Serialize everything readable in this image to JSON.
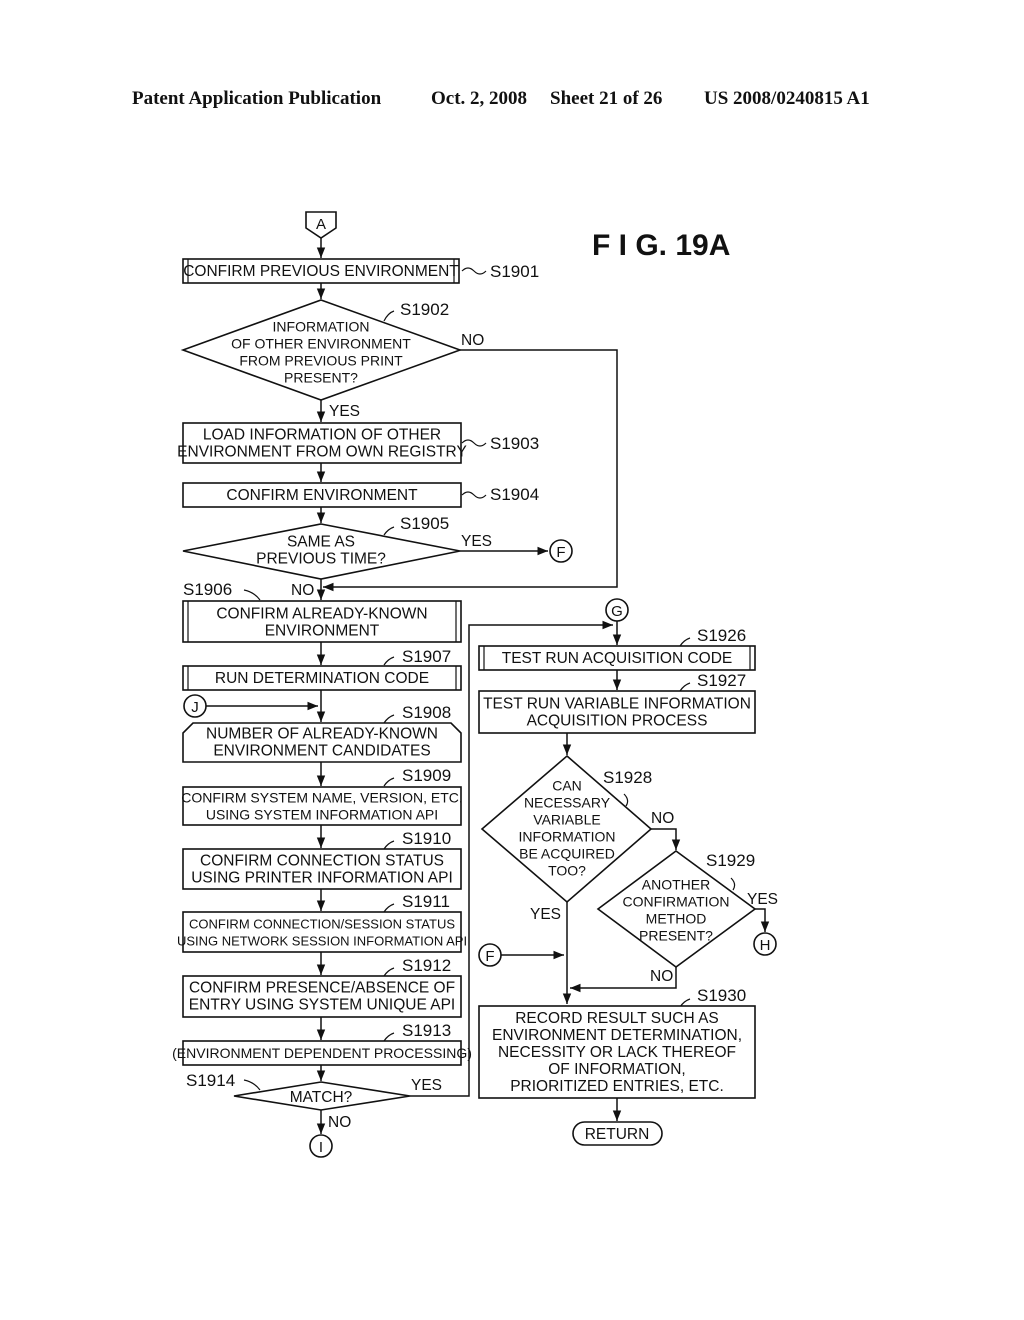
{
  "header": {
    "publication": "Patent Application Publication",
    "date": "Oct. 2, 2008",
    "sheet": "Sheet 21 of 26",
    "number": "US 2008/0240815 A1"
  },
  "figure_title": "F I G.  19A",
  "connectors": {
    "A": "A",
    "F": "F",
    "G": "G",
    "H": "H",
    "I": "I",
    "J": "J"
  },
  "branch_labels": {
    "yes": "YES",
    "no": "NO"
  },
  "steps": {
    "s1901": {
      "id": "S1901",
      "lines": [
        "CONFIRM PREVIOUS ENVIRONMENT"
      ]
    },
    "s1902": {
      "id": "S1902",
      "lines": [
        "INFORMATION",
        "OF OTHER ENVIRONMENT",
        "FROM PREVIOUS PRINT",
        "PRESENT?"
      ]
    },
    "s1903": {
      "id": "S1903",
      "lines": [
        "LOAD INFORMATION OF OTHER",
        "ENVIRONMENT FROM OWN REGISTRY"
      ]
    },
    "s1904": {
      "id": "S1904",
      "lines": [
        "CONFIRM ENVIRONMENT"
      ]
    },
    "s1905": {
      "id": "S1905",
      "lines": [
        "SAME AS",
        "PREVIOUS TIME?"
      ]
    },
    "s1906": {
      "id": "S1906",
      "lines": [
        "CONFIRM ALREADY-KNOWN",
        "ENVIRONMENT"
      ]
    },
    "s1907": {
      "id": "S1907",
      "lines": [
        "RUN DETERMINATION CODE"
      ]
    },
    "s1908": {
      "id": "S1908",
      "lines": [
        "NUMBER OF ALREADY-KNOWN",
        "ENVIRONMENT CANDIDATES"
      ]
    },
    "s1909": {
      "id": "S1909",
      "lines": [
        "CONFIRM SYSTEM NAME, VERSION, ETC.",
        "USING SYSTEM INFORMATION API"
      ]
    },
    "s1910": {
      "id": "S1910",
      "lines": [
        "CONFIRM CONNECTION STATUS",
        "USING PRINTER INFORMATION API"
      ]
    },
    "s1911": {
      "id": "S1911",
      "lines": [
        "CONFIRM CONNECTION/SESSION STATUS",
        "USING NETWORK SESSION INFORMATION API"
      ]
    },
    "s1912": {
      "id": "S1912",
      "lines": [
        "CONFIRM PRESENCE/ABSENCE OF",
        "ENTRY USING SYSTEM UNIQUE API"
      ]
    },
    "s1913": {
      "id": "S1913",
      "lines": [
        "(ENVIRONMENT DEPENDENT PROCESSING)"
      ]
    },
    "s1914": {
      "id": "S1914",
      "lines": [
        "MATCH?"
      ]
    },
    "s1926": {
      "id": "S1926",
      "lines": [
        "TEST RUN ACQUISITION CODE"
      ]
    },
    "s1927": {
      "id": "S1927",
      "lines": [
        "TEST RUN VARIABLE INFORMATION",
        "ACQUISITION PROCESS"
      ]
    },
    "s1928": {
      "id": "S1928",
      "lines": [
        "CAN",
        "NECESSARY",
        "VARIABLE",
        "INFORMATION",
        "BE ACQUIRED",
        "TOO?"
      ]
    },
    "s1929": {
      "id": "S1929",
      "lines": [
        "ANOTHER",
        "CONFIRMATION",
        "METHOD",
        "PRESENT?"
      ]
    },
    "s1930": {
      "id": "S1930",
      "lines": [
        "RECORD RESULT SUCH AS",
        "ENVIRONMENT DETERMINATION,",
        "NECESSITY OR LACK THEREOF",
        "OF INFORMATION,",
        "PRIORITIZED ENTRIES, ETC."
      ]
    },
    "return": {
      "lines": [
        "RETURN"
      ]
    }
  }
}
